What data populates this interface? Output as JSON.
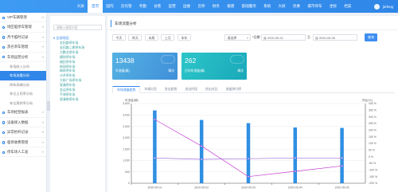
{
  "topnav": {
    "items": [
      "大屏",
      "首页",
      "园内",
      "云托管",
      "考勤",
      "访客",
      "运营",
      "运维",
      "云停",
      "财务",
      "报建",
      "基础服务",
      "系统",
      "大屏",
      "优惠",
      "城市停车",
      "坐标",
      "档案"
    ],
    "active_index": 1,
    "user": "jiefeng"
  },
  "sidebar": {
    "items": [
      {
        "label": "VIP车辆管理"
      },
      {
        "label": "场区临停车管理"
      },
      {
        "label": "月卡临时记录"
      },
      {
        "label": "黑名单车管理"
      },
      {
        "label": "车场运营分析"
      }
    ],
    "subitems": [
      {
        "label": "车场收入分析",
        "active": false
      },
      {
        "label": "车场流量分析",
        "active": true
      },
      {
        "label": "停车高峰分析",
        "active": false
      },
      {
        "label": "车位占用率分析",
        "active": false
      },
      {
        "label": "车位周转率分析",
        "active": false
      }
    ],
    "items_bottom": [
      {
        "label": "车场经营报表"
      },
      {
        "label": "设备接入数据"
      },
      {
        "label": "异常抬杆记录"
      },
      {
        "label": "临停收费管理"
      },
      {
        "label": "停车场人工发"
      }
    ]
  },
  "tree": {
    "search_placeholder": "请输入搜索内容",
    "root": "全部场区",
    "children": [
      "金田路停车场",
      "金田路二期停车场",
      "大鹏北停车场",
      "横岗停车场",
      "福田停车场",
      "新园停车场",
      "梅林停车场",
      "沙井停车场",
      "大新广场停车场",
      "观澜停车场",
      "金运停车场",
      "平湖停车场",
      "观澜南停车场"
    ]
  },
  "page": {
    "title": "车场流量分析",
    "quick_buttons": [
      "今天",
      "昨天",
      "本周",
      "上月",
      "本年"
    ],
    "select_value": "请选择",
    "filter_label": "*日期",
    "date_start": "2020-05-01",
    "date_sep": "至",
    "date_end": "2020-05-05",
    "search_label": "查询"
  },
  "cards": [
    {
      "value": "13438",
      "label": "车流量(辆)",
      "mark": "辆次",
      "color": "#4a9fdf"
    },
    {
      "value": "262",
      "label": "日均车流量(辆)",
      "mark": "辆次",
      "color": "#22b8c2"
    }
  ],
  "tabs": {
    "items": [
      "车场流量趋势",
      "车辆分型",
      "进出趋势",
      "进出时段",
      "进出对比",
      "流量排行榜"
    ],
    "active_index": 0
  },
  "chart_data": {
    "type": "bar",
    "ylabel": "车流量(辆)",
    "y2label": "同比(%)",
    "categories": [
      "2020-05-01",
      "2020-05-02",
      "2020-05-03",
      "2020-05-04",
      "2020-05-05"
    ],
    "ylim": [
      0,
      3500
    ],
    "yticks": [
      "0",
      "500",
      "1,000",
      "1,500",
      "2,000",
      "2,500",
      "3,000",
      "3,500"
    ],
    "y2lim": [
      -200,
      400
    ],
    "y2ticks": [
      "-200 %",
      "-150 %",
      "-100 %",
      "-50 %",
      "0 %",
      "50 %",
      "100 %",
      "150 %",
      "200 %",
      "250 %",
      "300 %",
      "350 %",
      "400 %"
    ],
    "series": [
      {
        "type": "bar",
        "values": [
          3200,
          2780,
          2640,
          2450,
          2430
        ],
        "color": "#2f8fe2"
      },
      {
        "type": "line",
        "values": [
          280,
          80,
          -150,
          -110,
          -70
        ],
        "color": "#c43ad0"
      },
      {
        "type": "line",
        "values": [
          -10,
          -20,
          -15,
          -10,
          -10
        ],
        "color": "#9b6bd9"
      }
    ]
  }
}
